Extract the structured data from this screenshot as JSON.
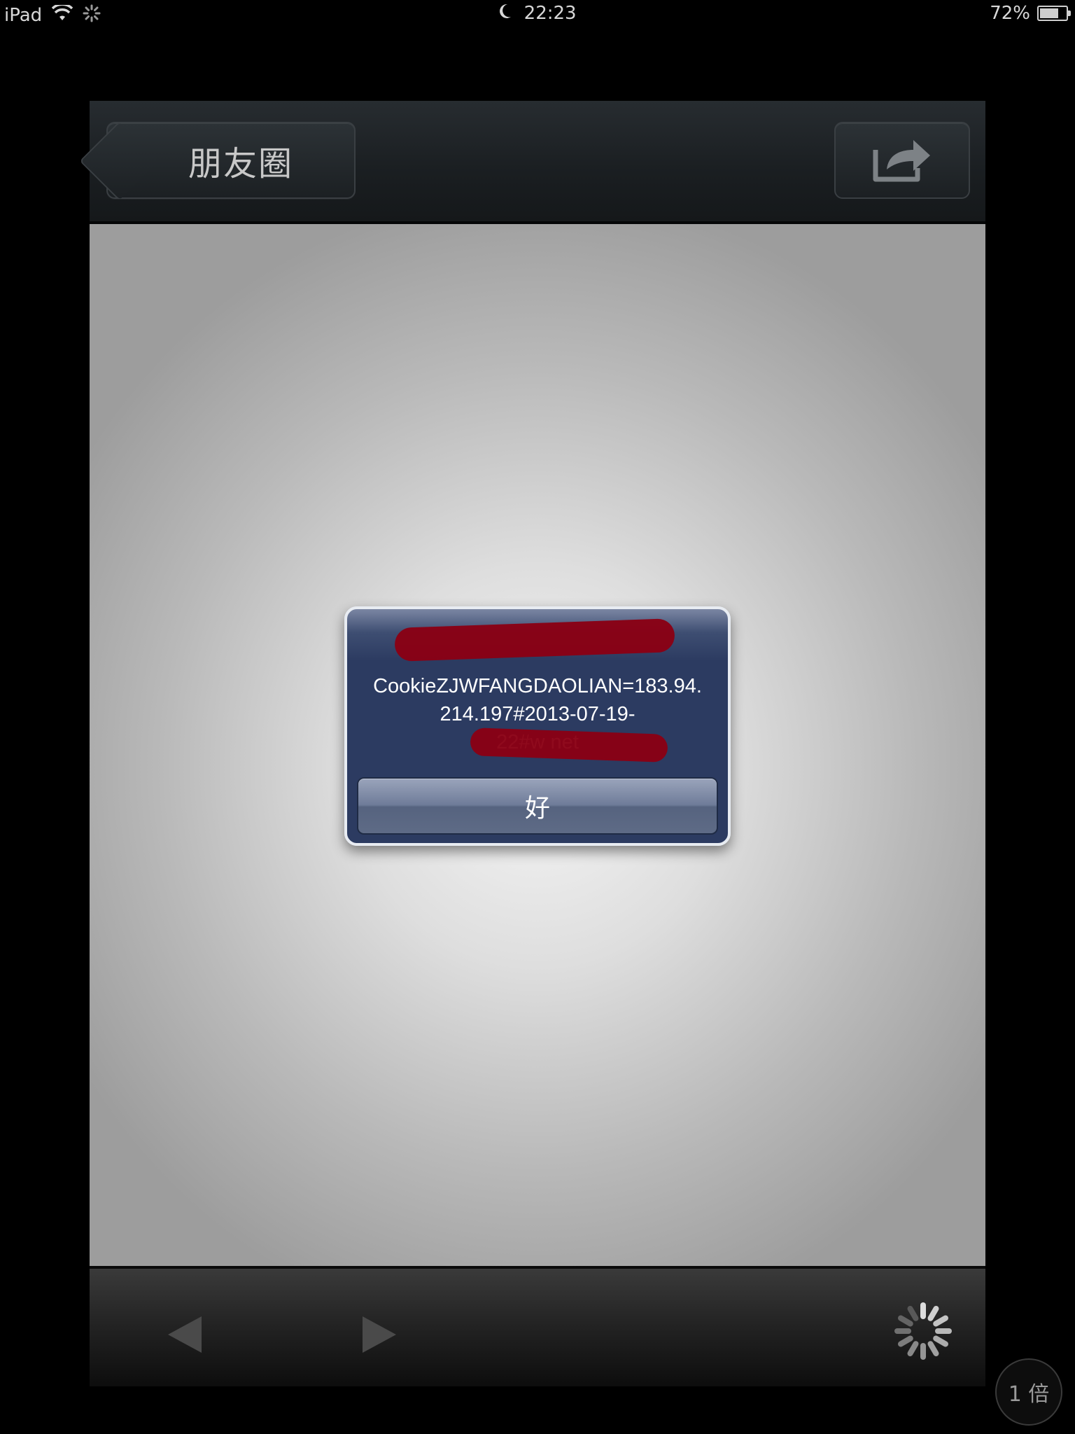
{
  "status_bar": {
    "device": "iPad",
    "time": "22:23",
    "battery": "72%",
    "battery_level": 0.72
  },
  "nav": {
    "back_label": "朋友圈",
    "share_icon": "share-icon"
  },
  "alert": {
    "title": "",
    "message_lines": [
      "CookieZJWFANGDAOLIAN=183.94.",
      "214.197#2013-07-19-",
      "22#w                    net"
    ],
    "ok_label": "好"
  },
  "toolbar": {
    "back_icon": "back-arrow-icon",
    "forward_icon": "forward-arrow-icon",
    "loading_icon": "loading-spinner-icon"
  },
  "zoom_badge": "1 倍",
  "colors": {
    "alert_bg": "#2c3b61",
    "redaction": "#8a0014",
    "nav_bg": "#1a1e21"
  }
}
